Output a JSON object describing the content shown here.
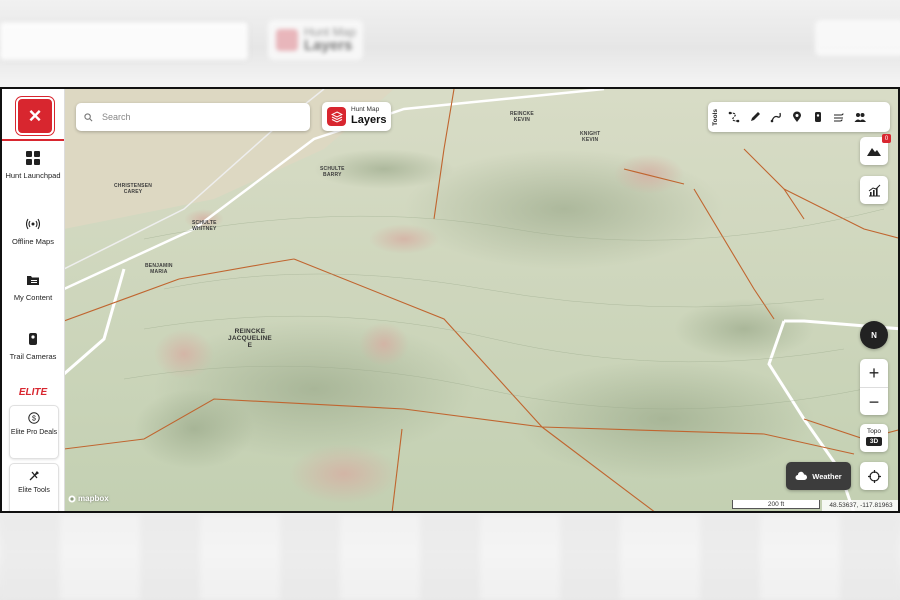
{
  "background": {
    "layers_small": "Hunt Map",
    "layers_big": "Layers"
  },
  "sidebar": {
    "close_symbol": "×",
    "items": [
      {
        "label": "Hunt Launchpad"
      },
      {
        "label": "Offline Maps"
      },
      {
        "label": "My Content"
      },
      {
        "label": "Trail Cameras"
      }
    ],
    "elite_logo": "ELITE",
    "elite_cards": [
      {
        "label": "Elite Pro Deals"
      },
      {
        "label": "Elite Tools"
      }
    ]
  },
  "search": {
    "placeholder": "Search"
  },
  "layers_button": {
    "subtitle": "Hunt Map",
    "title": "Layers"
  },
  "toolbar": {
    "label": "Tools",
    "icons": [
      "route-icon",
      "pencil-icon",
      "track-icon",
      "marker-icon",
      "phone-icon",
      "wind-icon",
      "group-icon"
    ]
  },
  "right_controls": {
    "alert_badge": "0",
    "compass_label": "N",
    "zoom_in": "+",
    "zoom_out": "−",
    "basemap_label": "Topo",
    "basemap_mode": "3D",
    "weather_label": "Weather"
  },
  "map": {
    "attribution": "mapbox",
    "scale_label": "200 ft",
    "coordinates": "48.53637, -117.81963",
    "labels": [
      {
        "text": "REINCKE\nJACQUELINE\nE"
      },
      {
        "text": "BENJAMIN\nMARIA"
      },
      {
        "text": "SCHULTE\nWHITNEY"
      },
      {
        "text": "SCHULTE\nBARRY"
      },
      {
        "text": "KNIGHT\nKEVIN"
      },
      {
        "text": "REINCKE\nKEVIN"
      },
      {
        "text": "CHRISTENSEN\nCAREY"
      }
    ]
  },
  "colors": {
    "brand_red": "#d8262f",
    "terrain_green": "#c6d3b6",
    "property_line": "#c0652f"
  }
}
